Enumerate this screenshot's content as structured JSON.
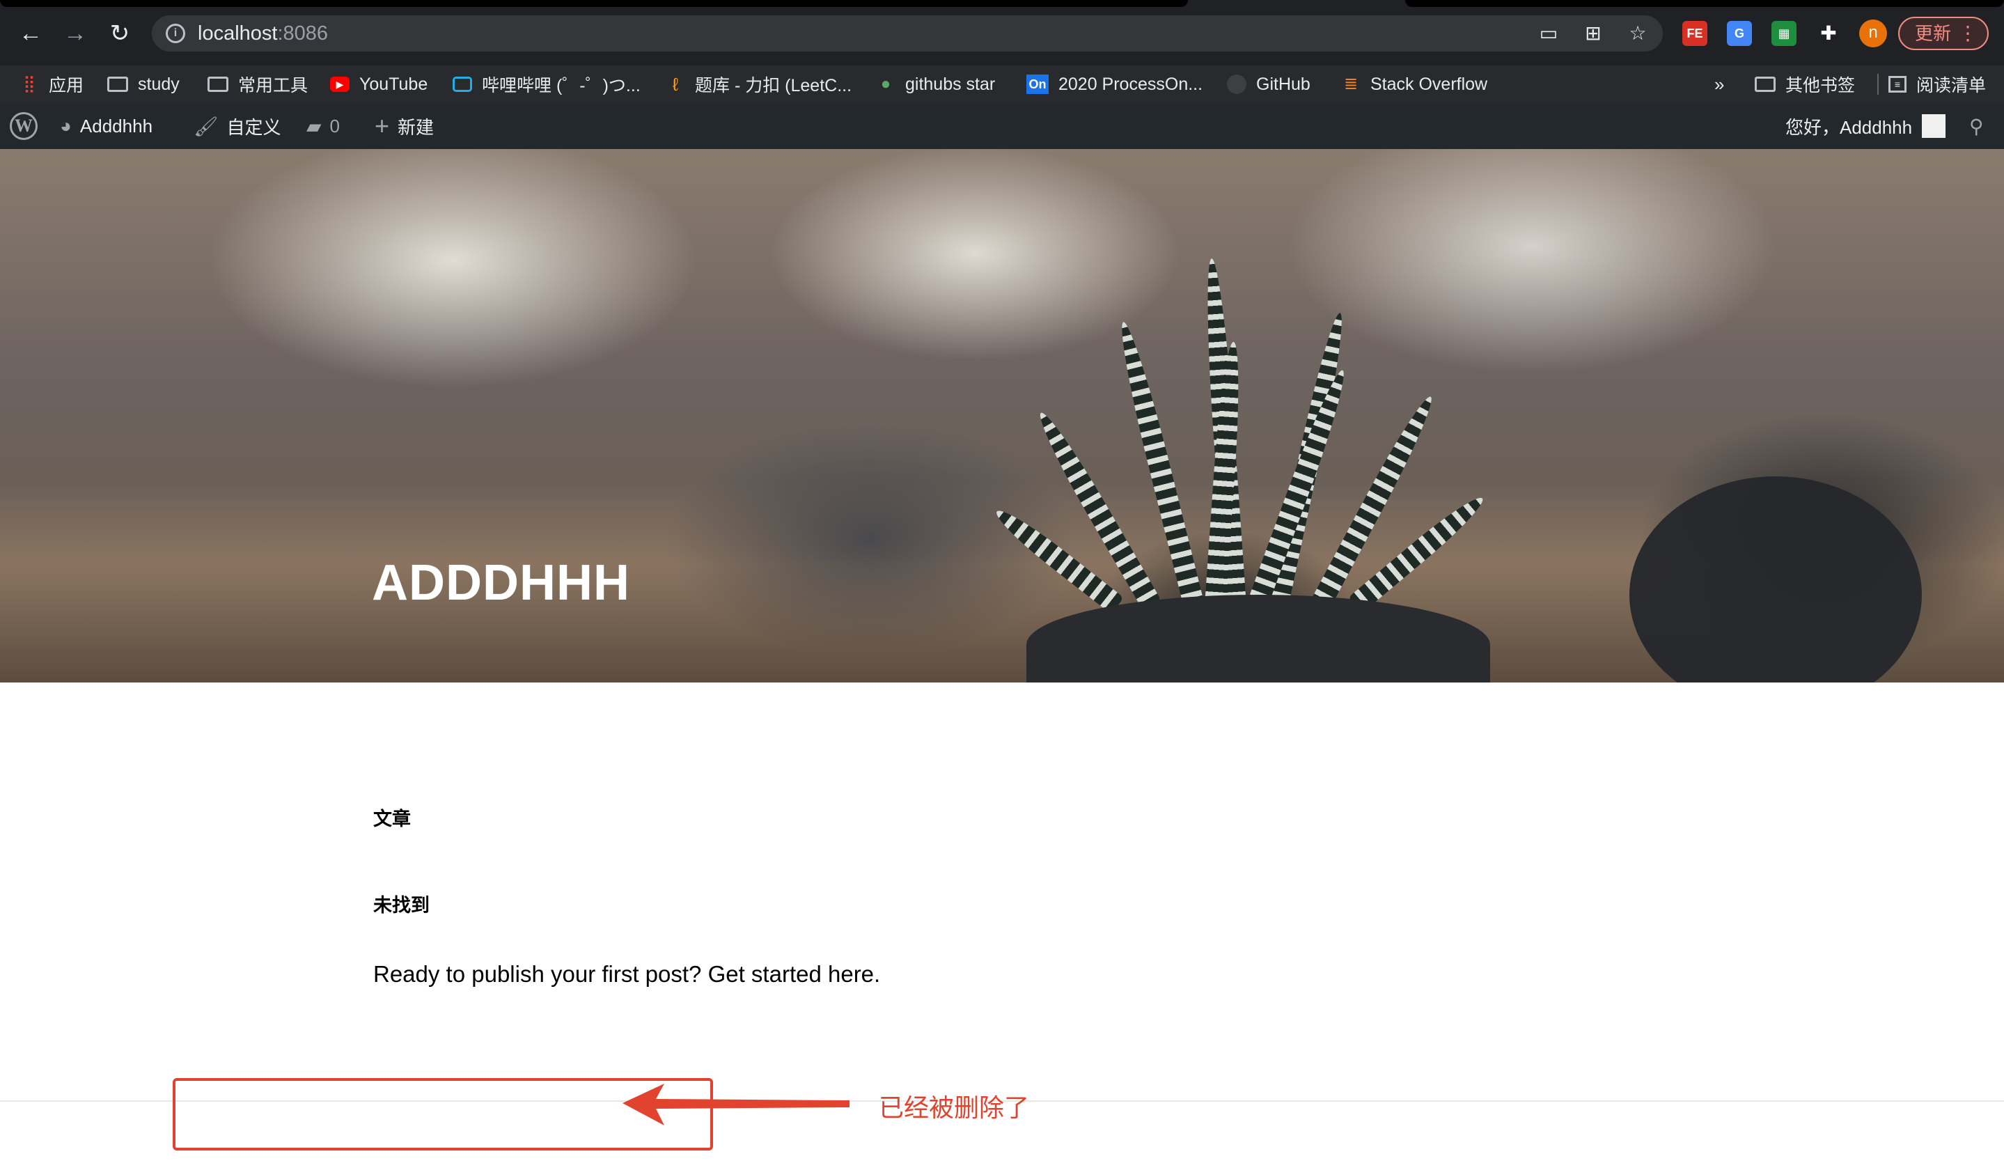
{
  "browser": {
    "url_host": "localhost",
    "url_port": ":8086",
    "update_label": "更新",
    "avatar_letter": "n",
    "extensions": [
      {
        "name": "fe-helper-icon",
        "label": "FE",
        "color": "#d93025"
      },
      {
        "name": "translate-icon",
        "label": "G",
        "color": "#4285f4"
      },
      {
        "name": "sheets-extension-icon",
        "label": "▦",
        "color": "#1e8e3e"
      },
      {
        "name": "puzzle-icon",
        "label": "✚",
        "color": "#202124"
      }
    ]
  },
  "bookmarks": {
    "items": [
      {
        "label": "应用",
        "icon": "apps-grid-icon"
      },
      {
        "label": "study",
        "icon": "folder-icon"
      },
      {
        "label": "常用工具",
        "icon": "folder-icon"
      },
      {
        "label": "YouTube",
        "icon": "youtube-icon"
      },
      {
        "label": "哔哩哔哩 (゜-゜)つ...",
        "icon": "bilibili-icon"
      },
      {
        "label": "题库 - 力扣 (LeetC...",
        "icon": "leetcode-icon"
      },
      {
        "label": "githubs star",
        "icon": "turtle-icon"
      },
      {
        "label": "2020 ProcessOn...",
        "icon": "processon-icon"
      },
      {
        "label": "GitHub",
        "icon": "github-icon"
      },
      {
        "label": "Stack Overflow",
        "icon": "stackoverflow-icon"
      }
    ],
    "overflow": "»",
    "other_label": "其他书签",
    "reading_list_label": "阅读清单"
  },
  "adminbar": {
    "site_name": "Adddhhh",
    "customize": "自定义",
    "comments_count": "0",
    "new_label": "新建",
    "greeting": "您好，Adddhhh"
  },
  "hero": {
    "title": "ADDDHHH"
  },
  "content": {
    "section_posts": "文章",
    "section_not_found": "未找到",
    "message": "Ready to publish your first post? Get started here."
  },
  "annotation": {
    "text": "已经被删除了",
    "color": "#e2432e"
  }
}
